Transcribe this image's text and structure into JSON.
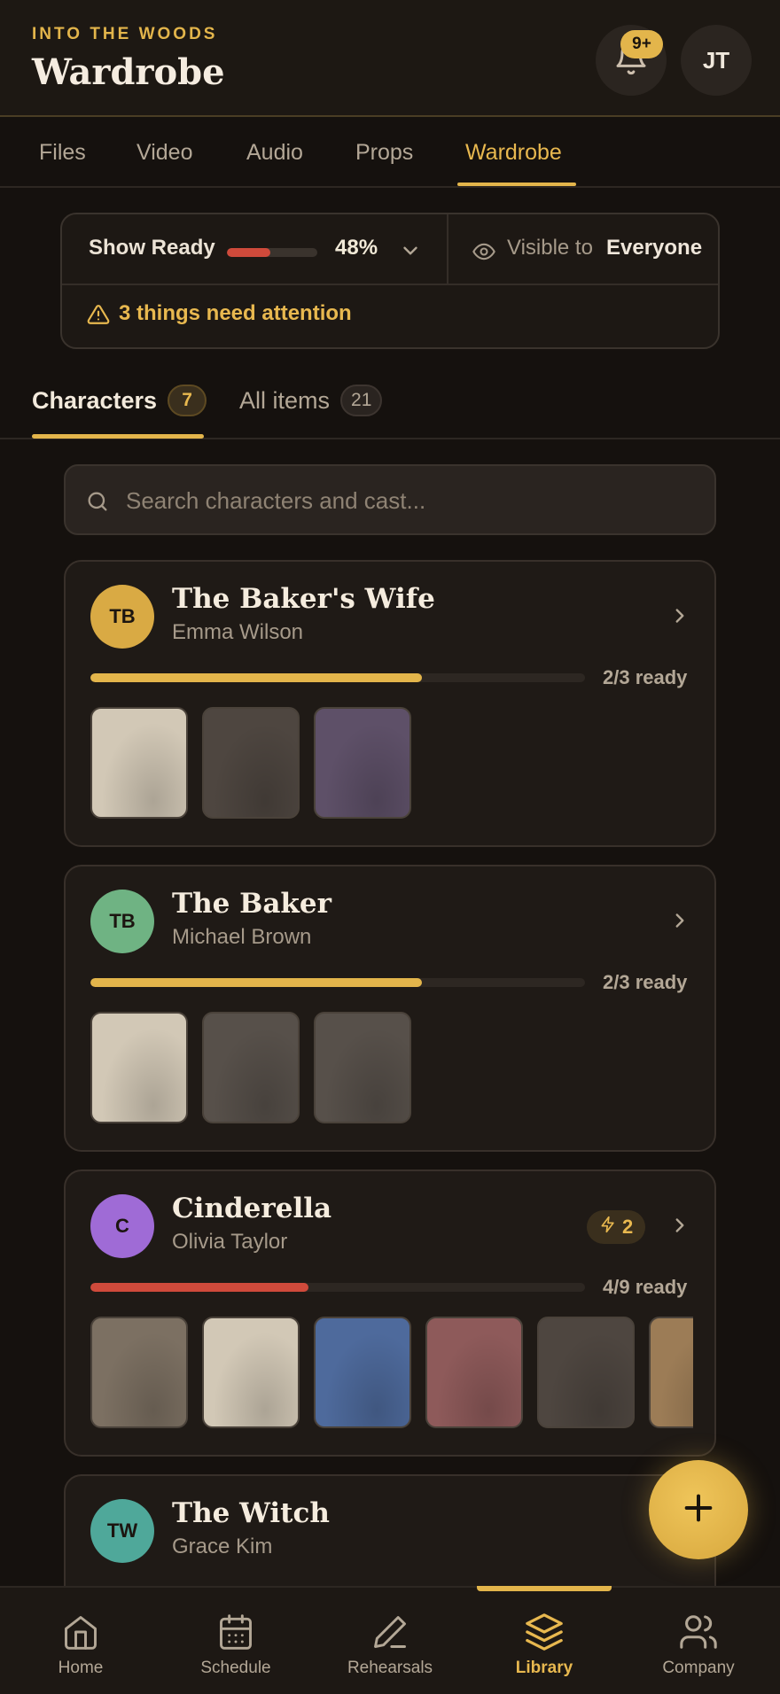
{
  "header": {
    "eyebrow": "INTO THE WOODS",
    "title": "Wardrobe",
    "notifications_badge": "9+",
    "user_initials": "JT"
  },
  "topnav": {
    "tabs": [
      {
        "label": "Files",
        "active": false
      },
      {
        "label": "Video",
        "active": false
      },
      {
        "label": "Audio",
        "active": false
      },
      {
        "label": "Props",
        "active": false
      },
      {
        "label": "Wardrobe",
        "active": true
      }
    ]
  },
  "status": {
    "show_ready_label": "Show Ready",
    "show_ready_pct_text": "48%",
    "show_ready_fraction": 0.48,
    "visible_label": "Visible to",
    "visible_value": "Everyone",
    "attention_text": "3 things need attention"
  },
  "section_tabs": [
    {
      "label": "Characters",
      "count": "7",
      "active": true
    },
    {
      "label": "All items",
      "count": "21",
      "active": false
    }
  ],
  "search": {
    "placeholder": "Search characters and cast..."
  },
  "characters": [
    {
      "initials": "TB",
      "avatar_color": "#d9aa44",
      "name": "The Baker's Wife",
      "actor": "Emma Wilson",
      "ready_text": "2/3 ready",
      "ready_fraction": 0.67,
      "bar_color": "#e3b54b",
      "badge": null,
      "thumbs": [
        "#d2c8b6",
        "#4e4640",
        "#5e5068"
      ]
    },
    {
      "initials": "TB",
      "avatar_color": "#6fb383",
      "name": "The Baker",
      "actor": "Michael Brown",
      "ready_text": "2/3 ready",
      "ready_fraction": 0.67,
      "bar_color": "#e3b54b",
      "badge": null,
      "thumbs": [
        "#d2c8b6",
        "#57504a",
        "#57504a"
      ]
    },
    {
      "initials": "C",
      "avatar_color": "#9f6bd6",
      "name": "Cinderella",
      "actor": "Olivia Taylor",
      "ready_text": "4/9 ready",
      "ready_fraction": 0.44,
      "bar_color": "#cf4a3b",
      "badge": "2",
      "thumbs": [
        "#7c7062",
        "#d2c8b6",
        "#4e6a9c",
        "#8e5a5a",
        "#4e4640",
        "#9c7c56"
      ]
    },
    {
      "initials": "TW",
      "avatar_color": "#4fa89a",
      "name": "The Witch",
      "actor": "Grace Kim",
      "ready_text": "",
      "ready_fraction": 0,
      "bar_color": "#e3b54b",
      "badge": null,
      "thumbs": []
    }
  ],
  "bottomnav": [
    {
      "label": "Home",
      "icon": "home-icon",
      "active": false
    },
    {
      "label": "Schedule",
      "icon": "calendar-icon",
      "active": false
    },
    {
      "label": "Rehearsals",
      "icon": "pen-icon",
      "active": false
    },
    {
      "label": "Library",
      "icon": "layers-icon",
      "active": true
    },
    {
      "label": "Company",
      "icon": "people-icon",
      "active": false
    }
  ],
  "colors": {
    "accent": "#e3b54b",
    "danger": "#cf4a3b",
    "background": "#15110e"
  }
}
